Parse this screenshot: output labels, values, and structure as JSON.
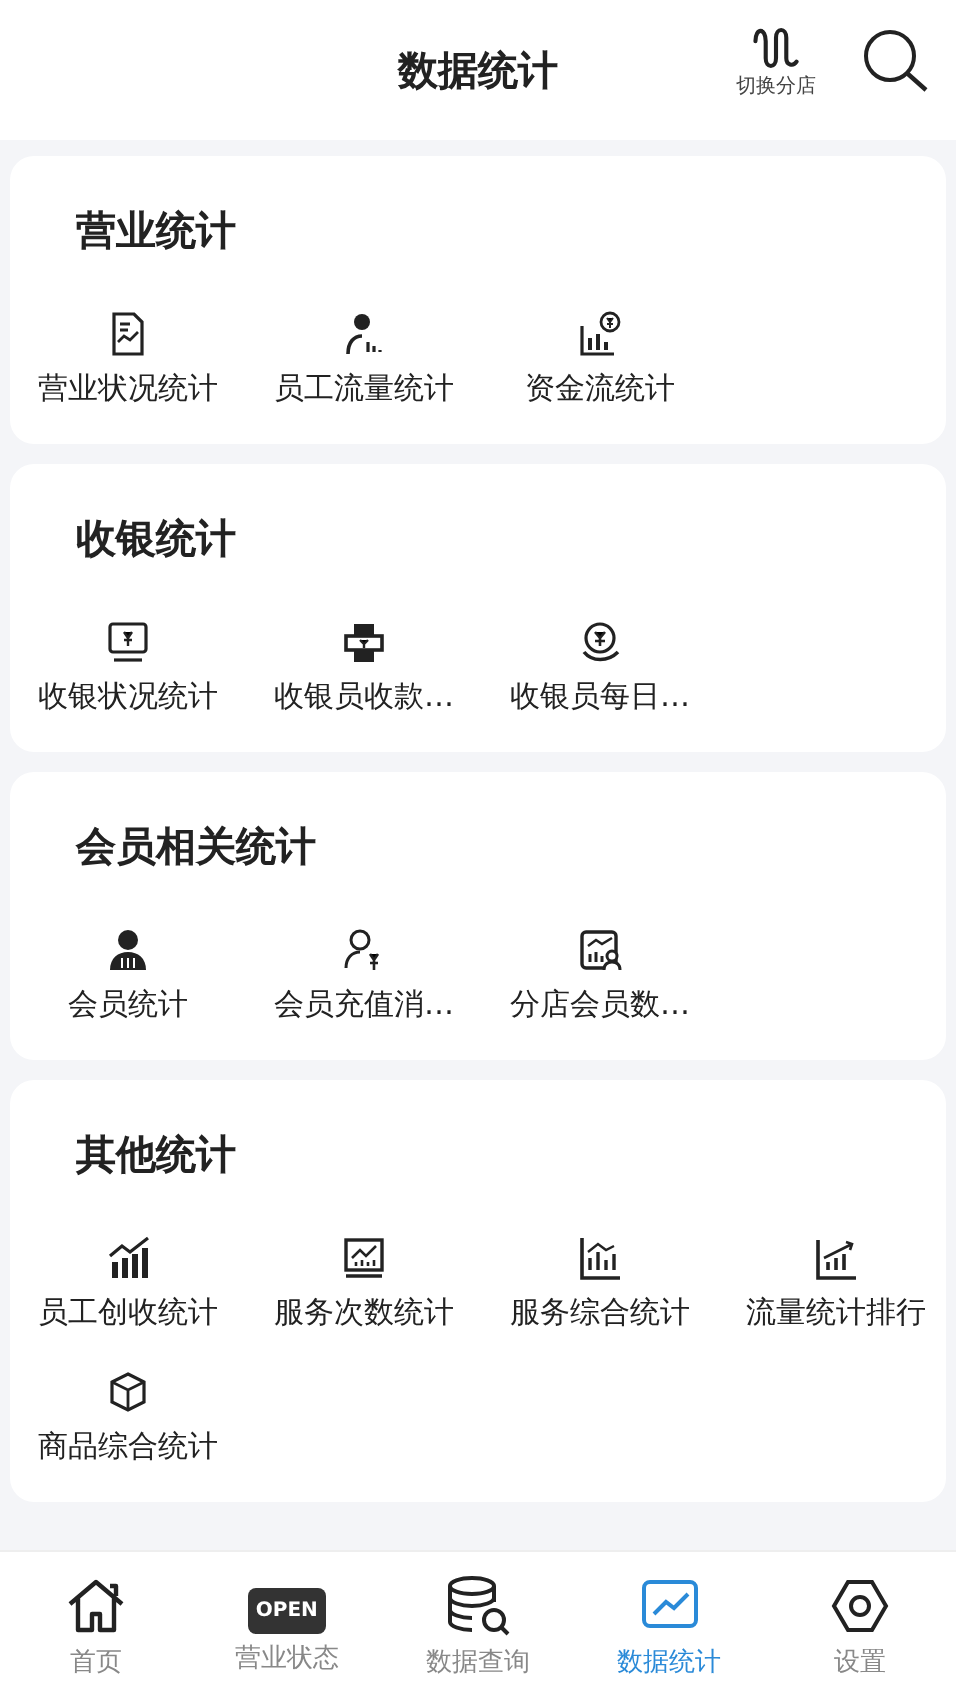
{
  "header": {
    "title": "数据统计",
    "switch_store": {
      "label": "切换分店"
    }
  },
  "sections": [
    {
      "title": "营业统计",
      "items": [
        {
          "label": "营业状况统计"
        },
        {
          "label": "员工流量统计"
        },
        {
          "label": "资金流统计"
        }
      ]
    },
    {
      "title": "收银统计",
      "items": [
        {
          "label": "收银状况统计"
        },
        {
          "label": "收银员收款…"
        },
        {
          "label": "收银员每日…"
        }
      ]
    },
    {
      "title": "会员相关统计",
      "items": [
        {
          "label": "会员统计"
        },
        {
          "label": "会员充值消…"
        },
        {
          "label": "分店会员数…"
        }
      ]
    },
    {
      "title": "其他统计",
      "items": [
        {
          "label": "员工创收统计"
        },
        {
          "label": "服务次数统计"
        },
        {
          "label": "服务综合统计"
        },
        {
          "label": "流量统计排行"
        },
        {
          "label": "商品综合统计"
        }
      ]
    }
  ],
  "tab_bar": [
    {
      "label": "首页",
      "selected": false
    },
    {
      "label": "营业状态",
      "selected": false,
      "icon_text": "OPEN"
    },
    {
      "label": "数据查询",
      "selected": false
    },
    {
      "label": "数据统计",
      "selected": true
    },
    {
      "label": "设置",
      "selected": false
    }
  ]
}
